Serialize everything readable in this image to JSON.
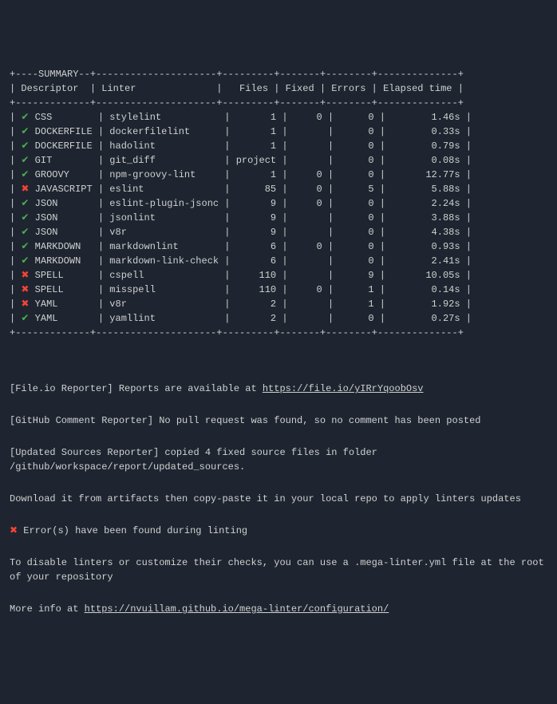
{
  "summary_label": "SUMMARY",
  "header": {
    "descriptor": "Descriptor",
    "linter": "Linter",
    "files": "Files",
    "fixed": "Fixed",
    "errors": "Errors",
    "elapsed": "Elapsed time"
  },
  "rows": [
    {
      "status": "ok",
      "descriptor": "CSS",
      "linter": "stylelint",
      "files": "1",
      "fixed": "0",
      "errors": "0",
      "elapsed": "1.46s"
    },
    {
      "status": "ok",
      "descriptor": "DOCKERFILE",
      "linter": "dockerfilelint",
      "files": "1",
      "fixed": "",
      "errors": "0",
      "elapsed": "0.33s"
    },
    {
      "status": "ok",
      "descriptor": "DOCKERFILE",
      "linter": "hadolint",
      "files": "1",
      "fixed": "",
      "errors": "0",
      "elapsed": "0.79s"
    },
    {
      "status": "ok",
      "descriptor": "GIT",
      "linter": "git_diff",
      "files": "project",
      "fixed": "",
      "errors": "0",
      "elapsed": "0.08s"
    },
    {
      "status": "ok",
      "descriptor": "GROOVY",
      "linter": "npm-groovy-lint",
      "files": "1",
      "fixed": "0",
      "errors": "0",
      "elapsed": "12.77s"
    },
    {
      "status": "fail",
      "descriptor": "JAVASCRIPT",
      "linter": "eslint",
      "files": "85",
      "fixed": "0",
      "errors": "5",
      "elapsed": "5.88s"
    },
    {
      "status": "ok",
      "descriptor": "JSON",
      "linter": "eslint-plugin-jsonc",
      "files": "9",
      "fixed": "0",
      "errors": "0",
      "elapsed": "2.24s"
    },
    {
      "status": "ok",
      "descriptor": "JSON",
      "linter": "jsonlint",
      "files": "9",
      "fixed": "",
      "errors": "0",
      "elapsed": "3.88s"
    },
    {
      "status": "ok",
      "descriptor": "JSON",
      "linter": "v8r",
      "files": "9",
      "fixed": "",
      "errors": "0",
      "elapsed": "4.38s"
    },
    {
      "status": "ok",
      "descriptor": "MARKDOWN",
      "linter": "markdownlint",
      "files": "6",
      "fixed": "0",
      "errors": "0",
      "elapsed": "0.93s"
    },
    {
      "status": "ok",
      "descriptor": "MARKDOWN",
      "linter": "markdown-link-check",
      "files": "6",
      "fixed": "",
      "errors": "0",
      "elapsed": "2.41s"
    },
    {
      "status": "fail",
      "descriptor": "SPELL",
      "linter": "cspell",
      "files": "110",
      "fixed": "",
      "errors": "9",
      "elapsed": "10.05s"
    },
    {
      "status": "fail",
      "descriptor": "SPELL",
      "linter": "misspell",
      "files": "110",
      "fixed": "0",
      "errors": "1",
      "elapsed": "0.14s"
    },
    {
      "status": "fail",
      "descriptor": "YAML",
      "linter": "v8r",
      "files": "2",
      "fixed": "",
      "errors": "1",
      "elapsed": "1.92s"
    },
    {
      "status": "ok",
      "descriptor": "YAML",
      "linter": "yamllint",
      "files": "2",
      "fixed": "",
      "errors": "0",
      "elapsed": "0.27s"
    }
  ],
  "footer": {
    "fileio_prefix": "[File.io Reporter] Reports are available at ",
    "fileio_link": "https://file.io/yIRrYqoobOsv",
    "gh_comment": "[GitHub Comment Reporter] No pull request was found, so no comment has been posted",
    "updated_sources": "[Updated Sources Reporter] copied 4 fixed source files in folder /github/workspace/report/updated_sources.",
    "download_hint": "Download it from artifacts then copy-paste it in your local repo to apply linters updates",
    "errors_found": " Error(s) have been found during linting",
    "disable_hint": "To disable linters or customize their checks, you can use a .mega-linter.yml file at the root of your repository",
    "more_info_prefix": "More info at ",
    "more_info_link": "https://nvuillam.github.io/mega-linter/configuration/"
  },
  "icons": {
    "ok": "✔",
    "fail": "✖"
  },
  "ascii": {
    "top": "+----SUMMARY--+---------------------+---------+-------+--------+--------------+",
    "header": "| Descriptor  | Linter              |   Files | Fixed | Errors | Elapsed time |",
    "sep": "+-------------+---------------------+---------+-------+--------+--------------+",
    "bottom": "+-------------+---------------------+---------+-------+--------+--------------+"
  }
}
